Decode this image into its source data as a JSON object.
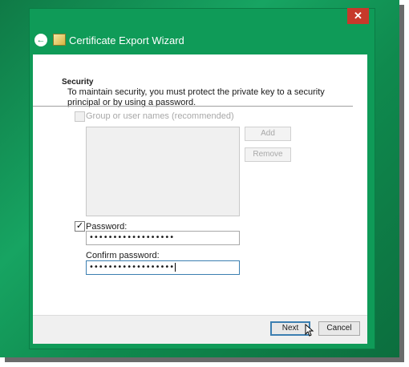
{
  "window": {
    "title": "Certificate Export Wizard",
    "close_glyph": "✕"
  },
  "icons": {
    "back": "back-arrow-icon",
    "wizard": "certificate-icon",
    "close": "close-icon",
    "cursor": "mouse-pointer-icon"
  },
  "section": {
    "title": "Security",
    "description": "To maintain security, you must protect the private key to a security principal or by using a password."
  },
  "group_option": {
    "label": "Group or user names (recommended)",
    "checked": false,
    "enabled": false
  },
  "list_buttons": {
    "add": "Add",
    "remove": "Remove"
  },
  "password": {
    "checkbox_label": "Password:",
    "checked": true,
    "value": "••••••••••••••••••"
  },
  "confirm": {
    "label": "Confirm password:",
    "value": "••••••••••••••••••"
  },
  "footer": {
    "next": "Next",
    "cancel": "Cancel"
  },
  "colors": {
    "accent": "#0f9b58",
    "close": "#c7392b",
    "focus": "#3c7fb1"
  }
}
